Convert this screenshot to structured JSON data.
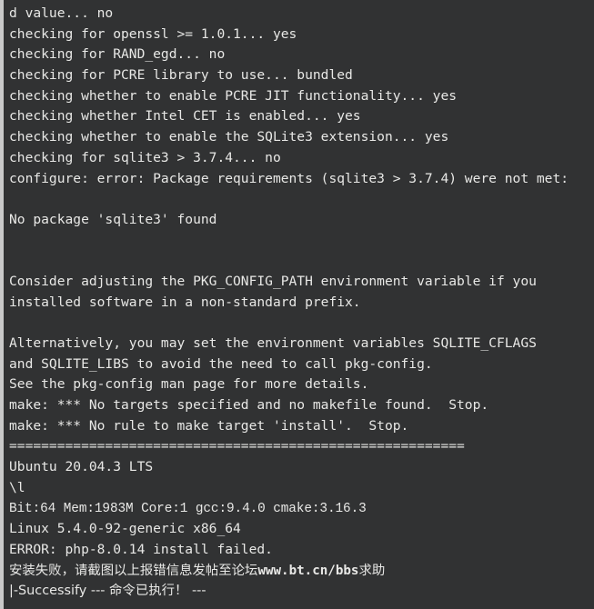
{
  "terminal": {
    "background_color": "#313233",
    "text_color": "#e8e8e6",
    "gutter_color": "#c9c9c9",
    "lines": [
      {
        "id": "l01",
        "text": "d value... no",
        "style": "mono"
      },
      {
        "id": "l02",
        "text": "checking for openssl >= 1.0.1... yes",
        "style": "mono"
      },
      {
        "id": "l03",
        "text": "checking for RAND_egd... no",
        "style": "mono"
      },
      {
        "id": "l04",
        "text": "checking for PCRE library to use... bundled",
        "style": "mono"
      },
      {
        "id": "l05",
        "text": "checking whether to enable PCRE JIT functionality... yes",
        "style": "mono"
      },
      {
        "id": "l06",
        "text": "checking whether Intel CET is enabled... yes",
        "style": "mono"
      },
      {
        "id": "l07",
        "text": "checking whether to enable the SQLite3 extension... yes",
        "style": "mono"
      },
      {
        "id": "l08",
        "text": "checking for sqlite3 > 3.7.4... no",
        "style": "mono"
      },
      {
        "id": "l09",
        "text": "configure: error: Package requirements (sqlite3 > 3.7.4) were not met:",
        "style": "mono"
      },
      {
        "id": "l10",
        "text": "",
        "style": "blank"
      },
      {
        "id": "l11",
        "text": "No package 'sqlite3' found",
        "style": "mono"
      },
      {
        "id": "l12",
        "text": "",
        "style": "blank"
      },
      {
        "id": "l13",
        "text": "",
        "style": "blank"
      },
      {
        "id": "l14",
        "text": "Consider adjusting the PKG_CONFIG_PATH environment variable if you",
        "style": "mono"
      },
      {
        "id": "l15",
        "text": "installed software in a non-standard prefix.",
        "style": "mono"
      },
      {
        "id": "l16",
        "text": "",
        "style": "blank"
      },
      {
        "id": "l17",
        "text": "Alternatively, you may set the environment variables SQLITE_CFLAGS",
        "style": "mono"
      },
      {
        "id": "l18",
        "text": "and SQLITE_LIBS to avoid the need to call pkg-config.",
        "style": "mono"
      },
      {
        "id": "l19",
        "text": "See the pkg-config man page for more details.",
        "style": "mono"
      },
      {
        "id": "l20",
        "text": "make: *** No targets specified and no makefile found.  Stop.",
        "style": "mono"
      },
      {
        "id": "l21",
        "text": "make: *** No rule to make target 'install'.  Stop.",
        "style": "mono"
      },
      {
        "id": "l22",
        "text": "=========================================================",
        "style": "rule"
      },
      {
        "id": "l23",
        "text": "Ubuntu 20.04.3 LTS",
        "style": "mono"
      },
      {
        "id": "l24",
        "text": "\\l",
        "style": "mono"
      },
      {
        "id": "l25",
        "text": "Bit:64 Mem:1983M Core:1 gcc:9.4.0 cmake:3.16.3",
        "style": "sysinfo"
      },
      {
        "id": "l26",
        "text": "Linux 5.4.0-92-generic x86_64",
        "style": "mono"
      },
      {
        "id": "l27",
        "text": "ERROR: php-8.0.14 install failed.",
        "style": "mono"
      }
    ],
    "cjk_lines": [
      {
        "id": "l28",
        "prefix": "安装失败，请截图以上报错信息发帖至论坛",
        "url": "www.bt.cn/bbs",
        "suffix": "求助"
      },
      {
        "id": "l29",
        "prefix": "|-Successify --- ",
        "url": "",
        "suffix": "命令已执行！ ---"
      }
    ]
  }
}
